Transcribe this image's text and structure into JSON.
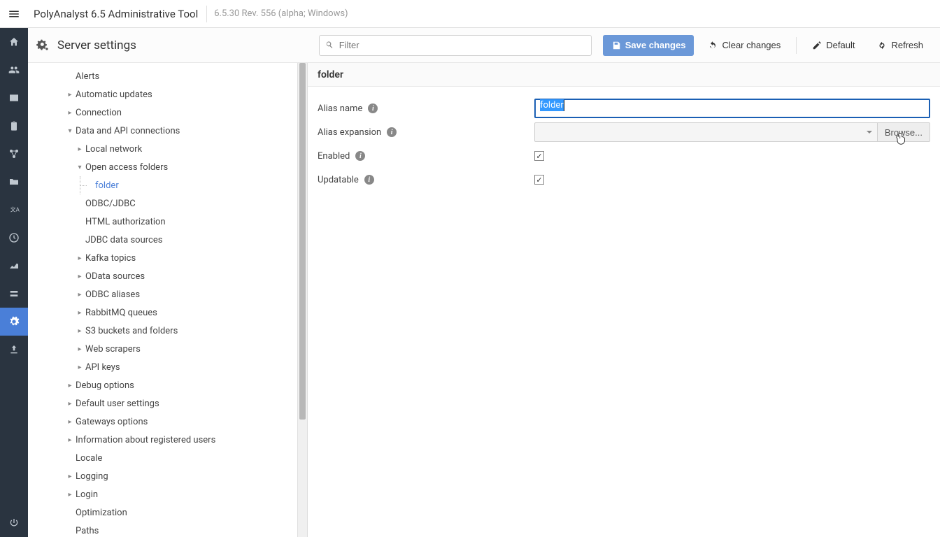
{
  "titlebar": {
    "main": "PolyAnalyst 6.5 Administrative Tool",
    "sub": "6.5.30 Rev. 556 (alpha; Windows)"
  },
  "page_title": "Server settings",
  "filter_placeholder": "Filter",
  "buttons": {
    "save": "Save changes",
    "clear": "Clear changes",
    "default": "Default",
    "refresh": "Refresh",
    "browse": "Browse..."
  },
  "tree": {
    "alerts": "Alerts",
    "auto_updates": "Automatic updates",
    "connection": "Connection",
    "data_api": "Data and API connections",
    "local_network": "Local network",
    "open_access": "Open access folders",
    "folder": "folder",
    "odbc_jdbc": "ODBC/JDBC",
    "html_auth": "HTML authorization",
    "jdbc_ds": "JDBC data sources",
    "kafka": "Kafka topics",
    "odata": "OData sources",
    "odbc_alias": "ODBC aliases",
    "rabbit": "RabbitMQ queues",
    "s3": "S3 buckets and folders",
    "web_scrapers": "Web scrapers",
    "api_keys": "API keys",
    "debug": "Debug options",
    "default_user": "Default user settings",
    "gateways": "Gateways options",
    "reg_users": "Information about registered users",
    "locale": "Locale",
    "logging": "Logging",
    "login": "Login",
    "optimization": "Optimization",
    "paths": "Paths"
  },
  "detail": {
    "header": "folder",
    "alias_name_lbl": "Alias name",
    "alias_name_val": "folder",
    "alias_exp_lbl": "Alias expansion",
    "enabled_lbl": "Enabled",
    "updatable_lbl": "Updatable"
  }
}
